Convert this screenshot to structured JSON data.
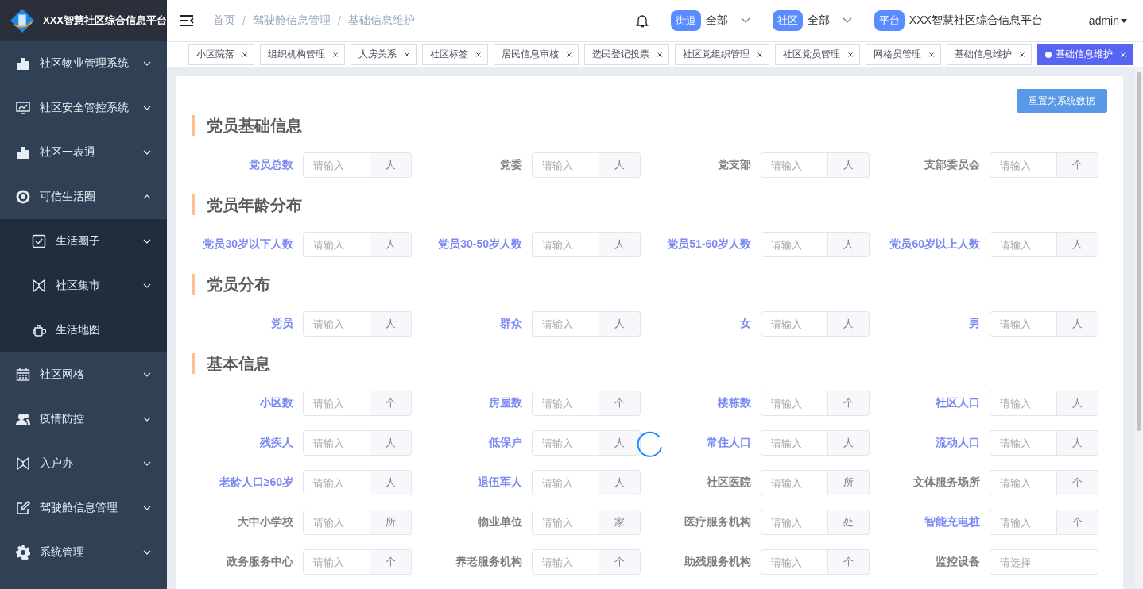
{
  "brand": {
    "title": "XXX智慧社区综合信息平台"
  },
  "sidebar": {
    "items": [
      {
        "label": "社区物业管理系统",
        "kind": "submenu",
        "expanded": false
      },
      {
        "label": "社区安全管控系统",
        "kind": "submenu",
        "expanded": false
      },
      {
        "label": "社区一表通",
        "kind": "submenu",
        "expanded": false
      },
      {
        "label": "可信生活圈",
        "kind": "submenu",
        "expanded": true,
        "children": [
          {
            "label": "生活圈子",
            "kind": "submenu",
            "expanded": false
          },
          {
            "label": "社区集市",
            "kind": "submenu",
            "expanded": false
          },
          {
            "label": "生活地图",
            "kind": "link"
          }
        ]
      },
      {
        "label": "社区网格",
        "kind": "submenu",
        "expanded": false
      },
      {
        "label": "疫情防控",
        "kind": "submenu",
        "expanded": false
      },
      {
        "label": "入户办",
        "kind": "submenu",
        "expanded": false
      },
      {
        "label": "驾驶舱信息管理",
        "kind": "submenu",
        "expanded": false
      },
      {
        "label": "系统管理",
        "kind": "submenu",
        "expanded": false
      }
    ]
  },
  "header": {
    "breadcrumb": {
      "separator": "/",
      "items": [
        "首页",
        "驾驶舱信息管理",
        "基础信息维护"
      ]
    },
    "filters": [
      {
        "tag": "街道",
        "value": "全部",
        "kind": "dropdown"
      },
      {
        "tag": "社区",
        "value": "全部",
        "kind": "dropdown"
      },
      {
        "tag": "平台",
        "value": "XXX智慧社区综合信息平台",
        "kind": "text"
      }
    ],
    "user": "admin"
  },
  "tabs": [
    {
      "label": "小区院落",
      "selected": false
    },
    {
      "label": "组织机构管理",
      "selected": false
    },
    {
      "label": "人房关系",
      "selected": false
    },
    {
      "label": "社区标签",
      "selected": false
    },
    {
      "label": "居民信息审核",
      "selected": false
    },
    {
      "label": "选民登记投票",
      "selected": false
    },
    {
      "label": "社区党组织管理",
      "selected": false
    },
    {
      "label": "社区党员管理",
      "selected": false
    },
    {
      "label": "网格员管理",
      "selected": false
    },
    {
      "label": "基础信息维护",
      "selected": false
    },
    {
      "label": "基础信息维护",
      "selected": true
    }
  ],
  "form": {
    "reset_button": "重置为系统数据",
    "loading": true,
    "sections": [
      {
        "title": "党员基础信息",
        "fields": [
          {
            "label": "党员总数",
            "highlighted": true,
            "kind": "input",
            "placeholder": "请输入",
            "unit": "人"
          },
          {
            "label": "党委",
            "highlighted": false,
            "kind": "input",
            "placeholder": "请输入",
            "unit": "人"
          },
          {
            "label": "党支部",
            "highlighted": false,
            "kind": "input",
            "placeholder": "请输入",
            "unit": "人"
          },
          {
            "label": "支部委员会",
            "highlighted": false,
            "kind": "input",
            "placeholder": "请输入",
            "unit": "个"
          }
        ]
      },
      {
        "title": "党员年龄分布",
        "fields": [
          {
            "label": "党员30岁以下人数",
            "highlighted": true,
            "kind": "input",
            "placeholder": "请输入",
            "unit": "人"
          },
          {
            "label": "党员30-50岁人数",
            "highlighted": true,
            "kind": "input",
            "placeholder": "请输入",
            "unit": "人"
          },
          {
            "label": "党员51-60岁人数",
            "highlighted": true,
            "kind": "input",
            "placeholder": "请输入",
            "unit": "人"
          },
          {
            "label": "党员60岁以上人数",
            "highlighted": true,
            "kind": "input",
            "placeholder": "请输入",
            "unit": "人"
          }
        ]
      },
      {
        "title": "党员分布",
        "fields": [
          {
            "label": "党员",
            "highlighted": true,
            "kind": "input",
            "placeholder": "请输入",
            "unit": "人"
          },
          {
            "label": "群众",
            "highlighted": true,
            "kind": "input",
            "placeholder": "请输入",
            "unit": "人"
          },
          {
            "label": "女",
            "highlighted": true,
            "kind": "input",
            "placeholder": "请输入",
            "unit": "人"
          },
          {
            "label": "男",
            "highlighted": true,
            "kind": "input",
            "placeholder": "请输入",
            "unit": "人"
          }
        ]
      },
      {
        "title": "基本信息",
        "fields": [
          {
            "label": "小区数",
            "highlighted": true,
            "kind": "input",
            "placeholder": "请输入",
            "unit": "个"
          },
          {
            "label": "房屋数",
            "highlighted": true,
            "kind": "input",
            "placeholder": "请输入",
            "unit": "个"
          },
          {
            "label": "楼栋数",
            "highlighted": true,
            "kind": "input",
            "placeholder": "请输入",
            "unit": "个"
          },
          {
            "label": "社区人口",
            "highlighted": true,
            "kind": "input",
            "placeholder": "请输入",
            "unit": "人"
          },
          {
            "label": "残疾人",
            "highlighted": true,
            "kind": "input",
            "placeholder": "请输入",
            "unit": "人"
          },
          {
            "label": "低保户",
            "highlighted": true,
            "kind": "input",
            "placeholder": "请输入",
            "unit": "人"
          },
          {
            "label": "常住人口",
            "highlighted": true,
            "kind": "input",
            "placeholder": "请输入",
            "unit": "人"
          },
          {
            "label": "流动人口",
            "highlighted": true,
            "kind": "input",
            "placeholder": "请输入",
            "unit": "人"
          },
          {
            "label": "老龄人口≥60岁",
            "highlighted": true,
            "kind": "input",
            "placeholder": "请输入",
            "unit": "人"
          },
          {
            "label": "退伍军人",
            "highlighted": true,
            "kind": "input",
            "placeholder": "请输入",
            "unit": "人"
          },
          {
            "label": "社区医院",
            "highlighted": false,
            "kind": "input",
            "placeholder": "请输入",
            "unit": "所"
          },
          {
            "label": "文体服务场所",
            "highlighted": false,
            "kind": "input",
            "placeholder": "请输入",
            "unit": "个"
          },
          {
            "label": "大中小学校",
            "highlighted": false,
            "kind": "input",
            "placeholder": "请输入",
            "unit": "所"
          },
          {
            "label": "物业单位",
            "highlighted": false,
            "kind": "input",
            "placeholder": "请输入",
            "unit": "家"
          },
          {
            "label": "医疗服务机构",
            "highlighted": false,
            "kind": "input",
            "placeholder": "请输入",
            "unit": "处"
          },
          {
            "label": "智能充电桩",
            "highlighted": true,
            "kind": "input",
            "placeholder": "请输入",
            "unit": "个"
          },
          {
            "label": "政务服务中心",
            "highlighted": false,
            "kind": "input",
            "placeholder": "请输入",
            "unit": "个"
          },
          {
            "label": "养老服务机构",
            "highlighted": false,
            "kind": "input",
            "placeholder": "请输入",
            "unit": "个"
          },
          {
            "label": "助残服务机构",
            "highlighted": false,
            "kind": "input",
            "placeholder": "请输入",
            "unit": "个"
          },
          {
            "label": "监控设备",
            "highlighted": false,
            "kind": "select",
            "placeholder": "请选择"
          }
        ]
      }
    ]
  }
}
